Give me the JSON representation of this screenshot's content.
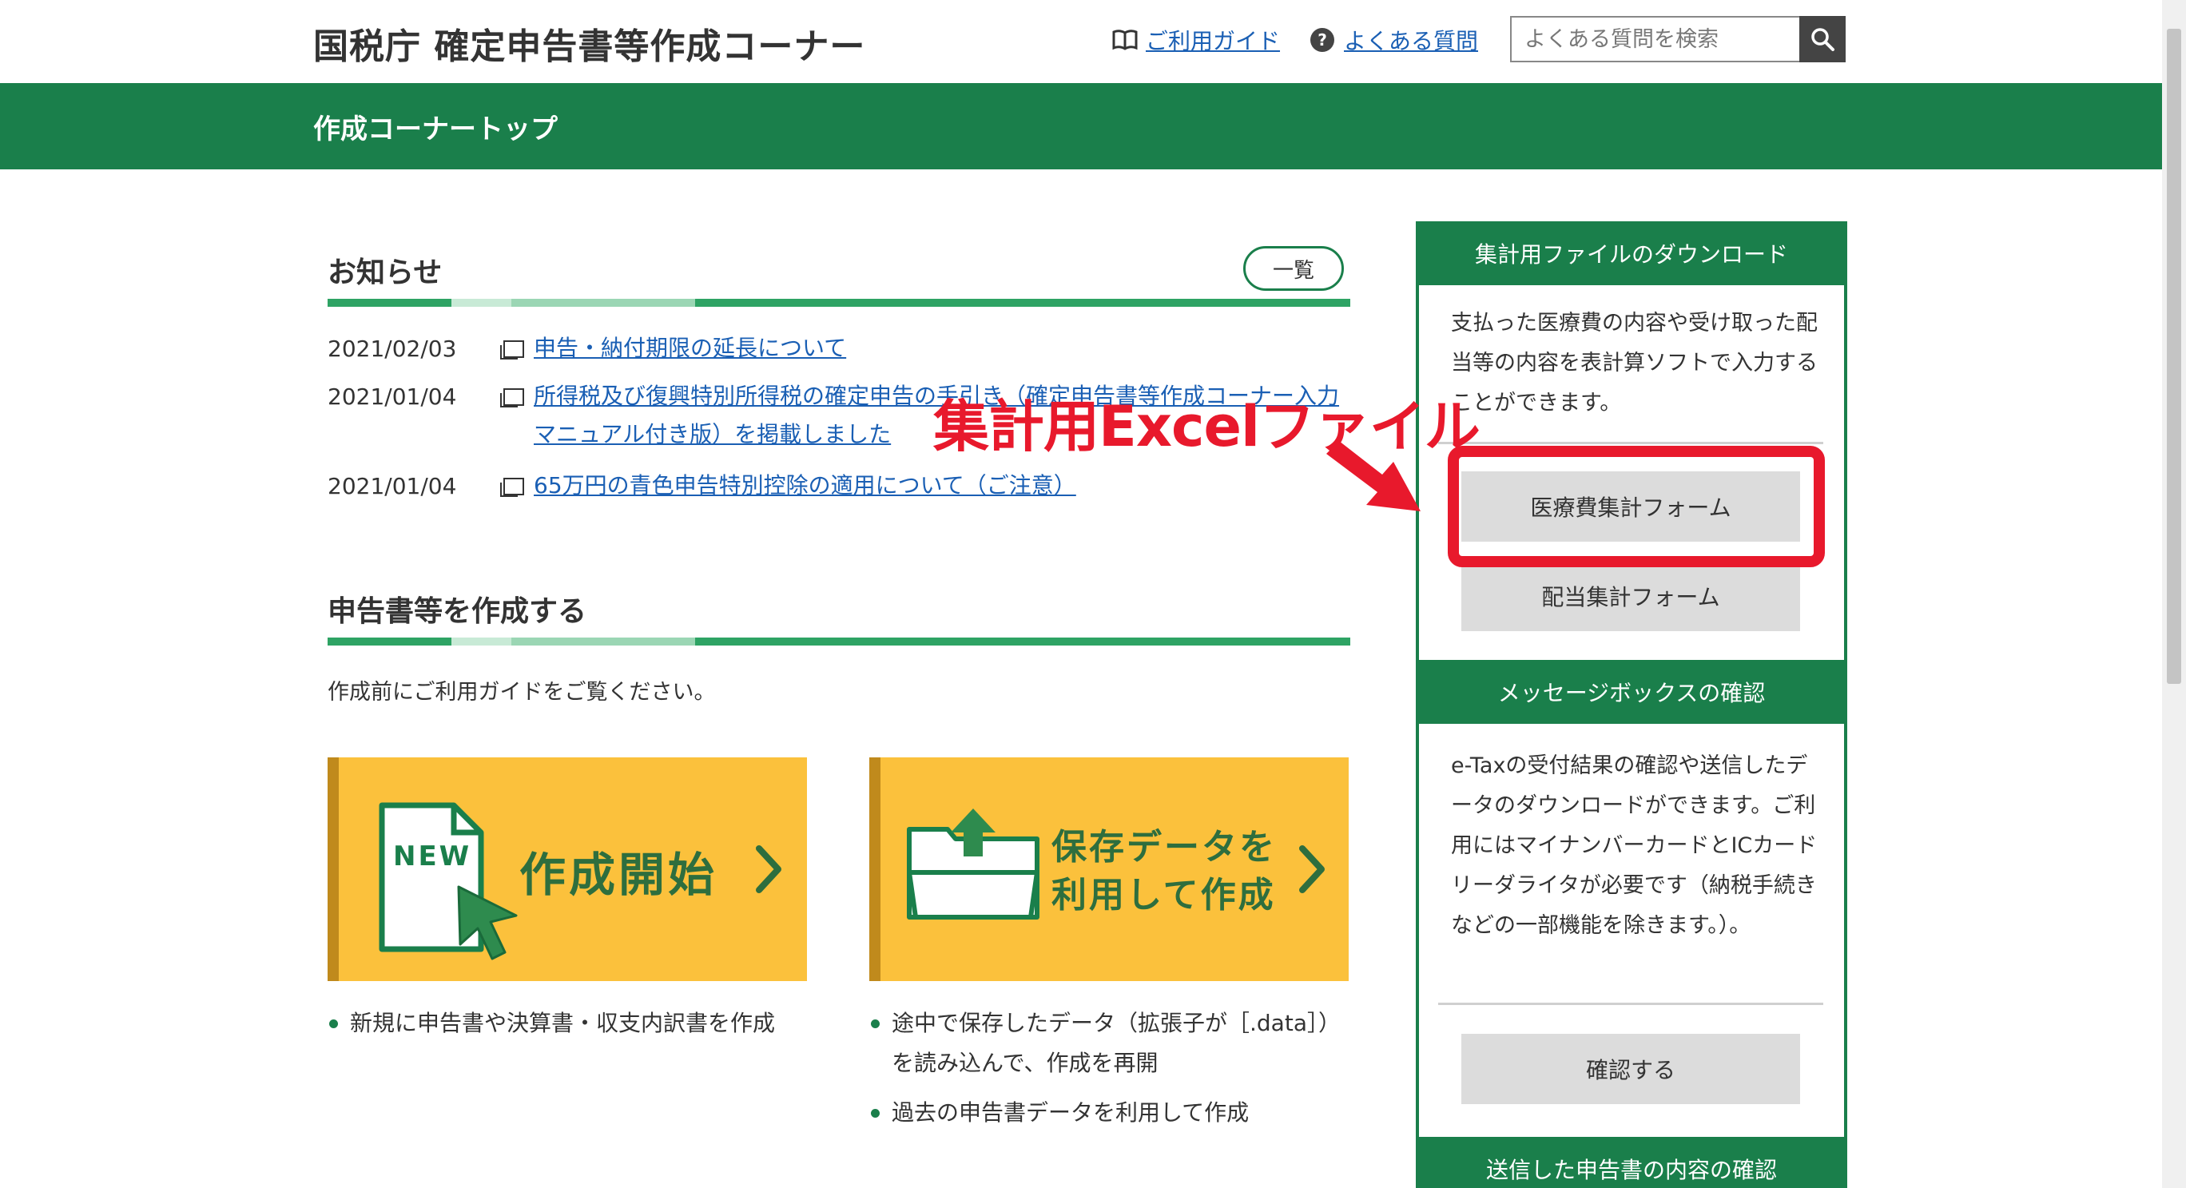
{
  "header": {
    "site_title": "国税庁 確定申告書等作成コーナー",
    "guide_link": "ご利用ガイド",
    "faq_link": "よくある質問",
    "search_placeholder": "よくある質問を検索"
  },
  "band": {
    "title": "作成コーナートップ"
  },
  "news": {
    "heading": "お知らせ",
    "list_button": "一覧",
    "items": [
      {
        "date": "2021/02/03",
        "text": "申告・納付期限の延長について"
      },
      {
        "date": "2021/01/04",
        "text": "所得税及び復興特別所得税の確定申告の手引き（確定申告書等作成コーナー入力マニュアル付き版）を掲載しました"
      },
      {
        "date": "2021/01/04",
        "text": "65万円の青色申告特別控除の適用について（ご注意）"
      }
    ]
  },
  "create": {
    "heading": "申告書等を作成する",
    "note": "作成前にご利用ガイドをご覧ください。",
    "start": {
      "badge": "NEW",
      "label": "作成開始",
      "bullets": [
        "新規に申告書や決算書・収支内訳書を作成"
      ]
    },
    "saved": {
      "label_line1": "保存データを",
      "label_line2": "利用して作成",
      "bullets": [
        "途中で保存したデータ（拡張子が［.data］）を読み込んで、作成を再開",
        "過去の申告書データを利用して作成"
      ]
    }
  },
  "sidebar": {
    "download": {
      "heading": "集計用ファイルのダウンロード",
      "text": "支払った医療費の内容や受け取った配当等の内容を表計算ソフトで入力することができます。",
      "btn_medical": "医療費集計フォーム",
      "btn_dividend": "配当集計フォーム"
    },
    "messagebox": {
      "heading": "メッセージボックスの確認",
      "text": "e-Taxの受付結果の確認や送信したデータのダウンロードができます。ご利用にはマイナンバーカードとICカードリーダライタが必要です（納税手続きなどの一部機能を除きます。）。",
      "button": "確認する"
    },
    "sent": {
      "heading": "送信した申告書の内容の確認"
    }
  },
  "annotation": {
    "label": "集計用Excelファイル"
  },
  "colors": {
    "green": "#1a7f4b",
    "yellow": "#fbc13c",
    "annotation_red": "#e8192c",
    "link": "#1a5fb4"
  },
  "icons": [
    "book-icon",
    "question-icon",
    "search-icon",
    "external-window-icon",
    "new-file-icon",
    "cursor-arrow-icon",
    "folder-upload-icon",
    "chevron-right-icon",
    "red-arrow-icon"
  ]
}
